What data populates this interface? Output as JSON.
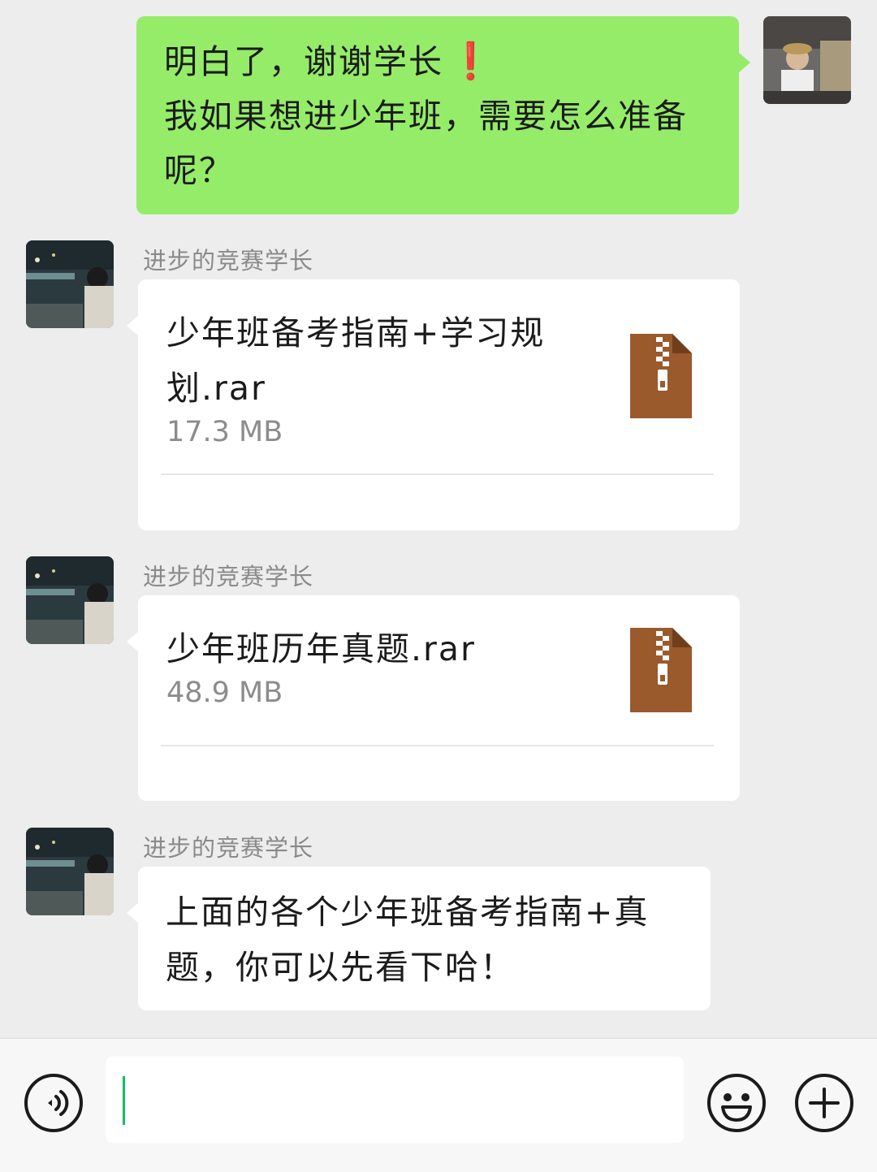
{
  "messages": {
    "outgoing": {
      "line1": "明白了，谢谢学长",
      "exclamation": "❗",
      "line2": "我如果想进少年班，需要怎么准备",
      "line3": "呢？"
    },
    "incoming": [
      {
        "sender": "进步的竞赛学长",
        "type": "file",
        "file_name": "少年班备考指南+学习规划.rar",
        "file_size": "17.3 MB",
        "icon": "zip-file-icon"
      },
      {
        "sender": "进步的竞赛学长",
        "type": "file",
        "file_name": "少年班历年真题.rar",
        "file_size": "48.9 MB",
        "icon": "zip-file-icon"
      },
      {
        "sender": "进步的竞赛学长",
        "type": "text",
        "text": "上面的各个少年班备考指南+真题，你可以先看下哈！"
      }
    ]
  },
  "input_bar": {
    "value": "",
    "icons": [
      "voice-icon",
      "emoji-icon",
      "plus-icon"
    ]
  },
  "colors": {
    "outgoing_bubble": "#95ec69",
    "incoming_bubble": "#ffffff",
    "background": "#ededed",
    "file_icon": "#9a5a2c",
    "cursor": "#07c160"
  }
}
